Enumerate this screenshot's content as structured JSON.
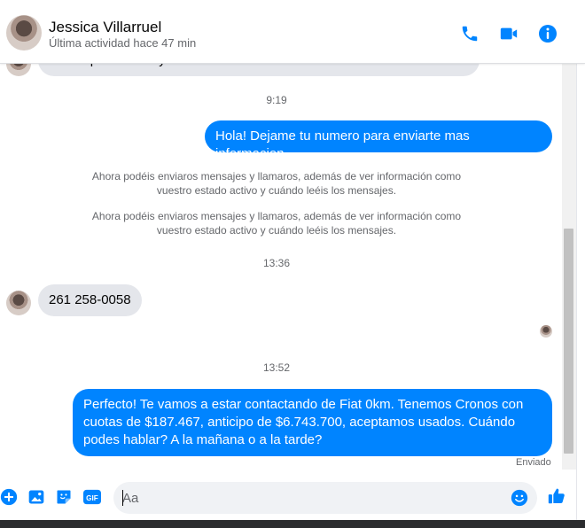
{
  "header": {
    "name": "Jessica Villarruel",
    "status": "Última actividad hace 47 min",
    "icons": [
      "phone-icon",
      "video-icon",
      "info-icon"
    ],
    "accent": "#0084ff"
  },
  "messages": {
    "partial_top": "saber qué auto es y de cuánto son las cuotas...",
    "time1": "9:19",
    "out1": "Hola! Dejame tu numero para enviarte mas informacion",
    "sys1": "Ahora podéis enviaros mensajes y llamaros, además de ver información como vuestro estado activo y cuándo leéis los mensajes.",
    "sys2": "Ahora podéis enviaros mensajes y llamaros, además de ver información como vuestro estado activo y cuándo leéis los mensajes.",
    "time2": "13:36",
    "in1": "261 258-0058",
    "time3": "13:52",
    "out2": "Perfecto! Te vamos a estar contactando de Fiat 0km. Tenemos Cronos con cuotas de $187.467, anticipo de $6.743.700, aceptamos usados. Cuándo podes hablar? A la mañana o a la tarde?",
    "sent_status": "Enviado"
  },
  "composer": {
    "placeholder": "Aa",
    "icons": [
      "plus-icon",
      "image-icon",
      "sticker-icon",
      "gif-icon",
      "emoji-icon",
      "like-icon"
    ],
    "gif_label": "GIF"
  }
}
